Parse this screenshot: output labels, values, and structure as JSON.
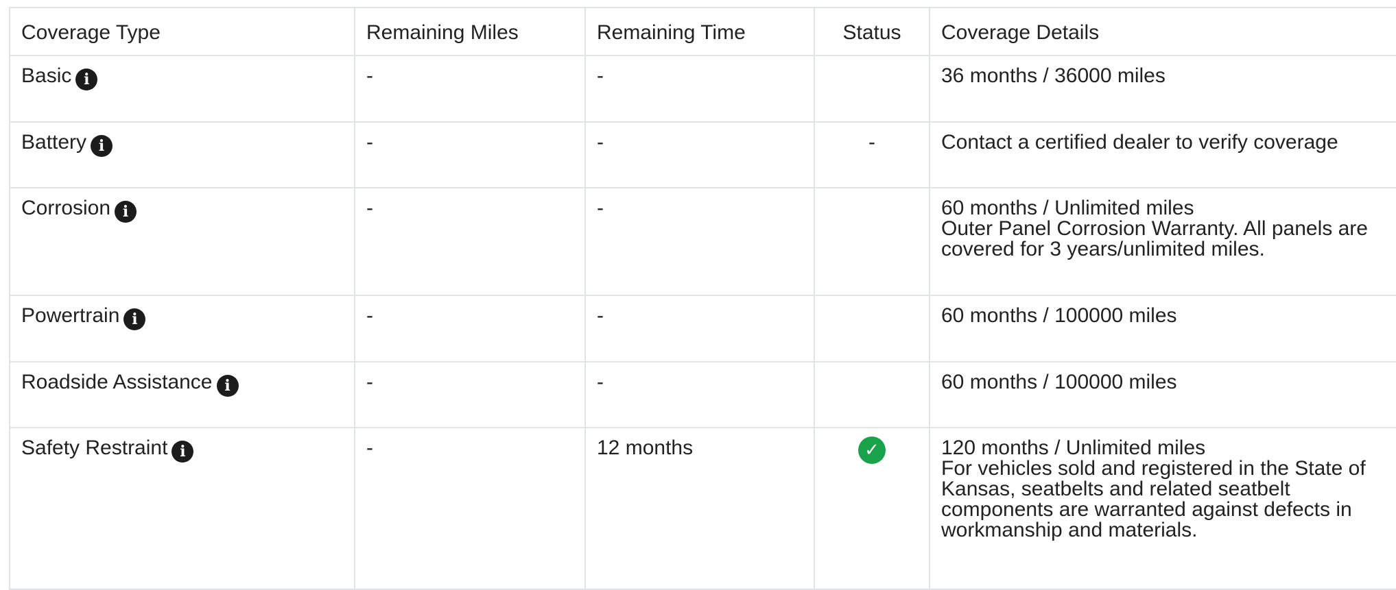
{
  "table": {
    "headers": {
      "coverage_type": "Coverage Type",
      "remaining_miles": "Remaining Miles",
      "remaining_time": "Remaining Time",
      "status": "Status",
      "coverage_details": "Coverage Details"
    },
    "rows": [
      {
        "coverage_type": "Basic",
        "remaining_miles": "-",
        "remaining_time": "-",
        "status": "",
        "details": "36 months / 36000 miles",
        "details_note": ""
      },
      {
        "coverage_type": "Battery",
        "remaining_miles": "-",
        "remaining_time": "-",
        "status": "-",
        "details": "Contact a certified dealer to verify coverage",
        "details_note": ""
      },
      {
        "coverage_type": "Corrosion",
        "remaining_miles": "-",
        "remaining_time": "-",
        "status": "",
        "details": "60 months / Unlimited miles",
        "details_note": "Outer Panel Corrosion Warranty. All panels are covered for 3 years/unlimited miles."
      },
      {
        "coverage_type": "Powertrain",
        "remaining_miles": "-",
        "remaining_time": "-",
        "status": "",
        "details": "60 months / 100000 miles",
        "details_note": ""
      },
      {
        "coverage_type": "Roadside Assistance",
        "remaining_miles": "-",
        "remaining_time": "-",
        "status": "",
        "details": "60 months / 100000 miles",
        "details_note": ""
      },
      {
        "coverage_type": "Safety Restraint",
        "remaining_miles": "-",
        "remaining_time": "12 months",
        "status": "active",
        "details": "120 months / Unlimited miles",
        "details_note": "For vehicles sold and registered in the State of Kansas, seatbelts and related seatbelt components are warranted against defects in workmanship and materials."
      }
    ],
    "icons": {
      "info": "info-icon",
      "status_active": "check-circle-icon"
    },
    "colors": {
      "status_active": "#18a34b",
      "border": "#e1e4e7",
      "text": "#222222"
    }
  }
}
